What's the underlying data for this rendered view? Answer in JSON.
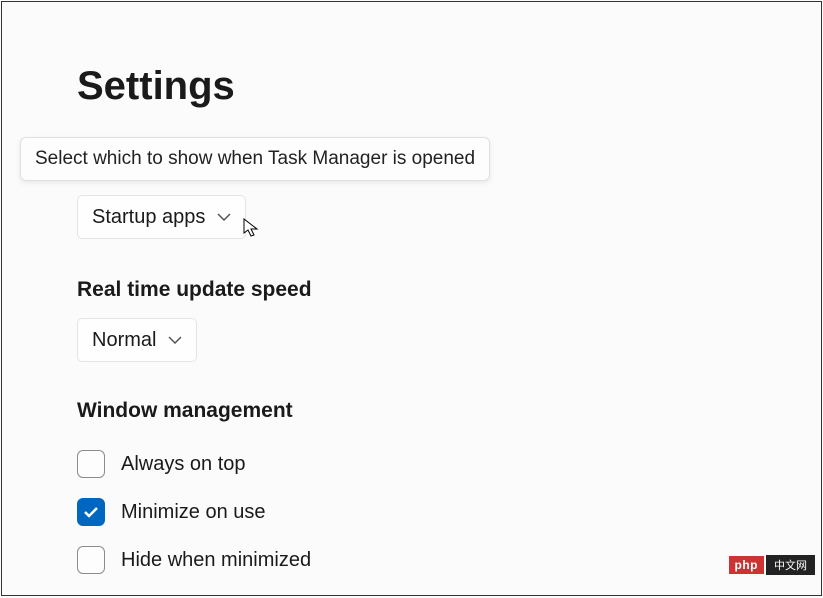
{
  "title": "Settings",
  "tooltip": "Select which to show when Task Manager is opened",
  "default_page": {
    "selected": "Startup apps"
  },
  "update_speed": {
    "label": "Real time update speed",
    "selected": "Normal"
  },
  "window_mgmt": {
    "label": "Window management",
    "items": [
      {
        "label": "Always on top",
        "checked": false
      },
      {
        "label": "Minimize on use",
        "checked": true
      },
      {
        "label": "Hide when minimized",
        "checked": false
      }
    ]
  },
  "watermark": {
    "left": "php",
    "right": "中文网"
  }
}
